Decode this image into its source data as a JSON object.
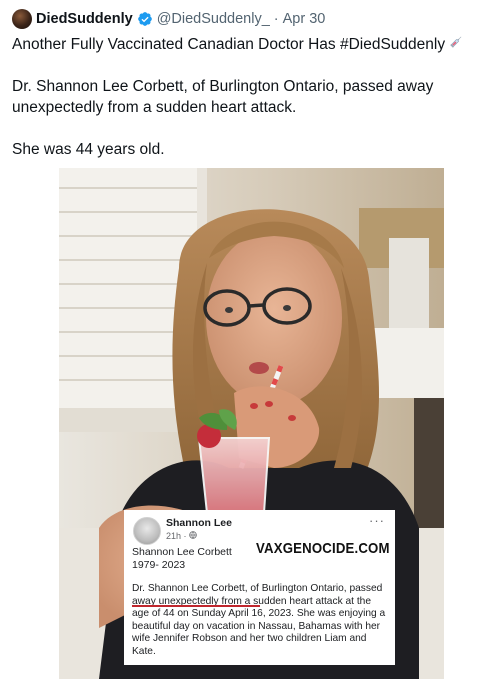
{
  "tweet": {
    "author_name": "DiedSuddenly",
    "handle": "@DiedSuddenly_",
    "separator": "·",
    "date": "Apr 30",
    "text_line1": "Another Fully Vaccinated Canadian Doctor Has #DiedSuddenly",
    "text_paragraph2": "Dr. Shannon Lee Corbett, of Burlington Ontario, passed away unexpectedly from a sudden heart attack.",
    "text_paragraph3": "She was 44 years old.",
    "inline_icon": "syringe-emoji",
    "verified_icon": "verified-badge-icon",
    "colors": {
      "verified": "#1d9bf0",
      "secondary_text": "#536471",
      "primary_text": "#0f1419"
    }
  },
  "embedded_post": {
    "name": "Shannon Lee",
    "time": "21h · ",
    "globe_icon": "globe-icon",
    "more": "···",
    "subject_name": "Shannon Lee Corbett",
    "years": "1979- 2023",
    "watermark": "VAXGENOCIDE.COM",
    "body": "Dr. Shannon Lee Corbett, of Burlington Ontario, passed away unexpectedly from a sudden heart attack at the age of 44 on Sunday April 16, 2023. She was enjoying a beautiful day on vacation in Nassau, Bahamas with her wife Jennifer Robson and her two children Liam and Kate.",
    "underline_color": "#c0262d"
  }
}
